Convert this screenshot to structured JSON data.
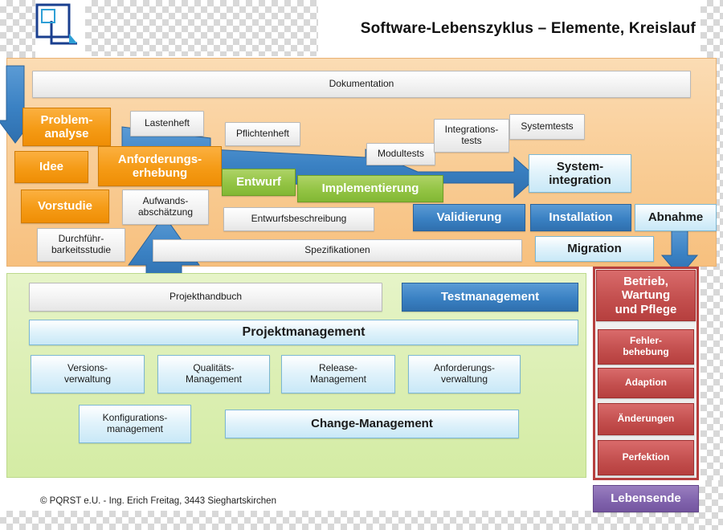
{
  "header": {
    "title": "Software-Lebenszyklus – Elemente, Kreislauf",
    "logo_name": "pqrst-logo"
  },
  "footer": {
    "copyright": "© PQRST e.U. - Ing. Erich Freitag, 3443 Sieghartskirchen"
  },
  "colors": {
    "orange": "#f59b16",
    "green": "#93c444",
    "blue": "#3a81c3",
    "cyan": "#c8e8f7",
    "red": "#c4504f",
    "purple": "#8265ae",
    "panel_orange": "#f9cd96",
    "panel_green": "#dcefb4"
  },
  "phase_panel": {
    "documentation": "Dokumentation",
    "boxes": [
      {
        "id": "problemanalyse",
        "label": "Problem-\nanalyse"
      },
      {
        "id": "idee",
        "label": "Idee"
      },
      {
        "id": "vorstudie",
        "label": "Vorstudie"
      },
      {
        "id": "durchfuehrbarkeitsstudie",
        "label": "Durchführ-\nbarkeitsstudie"
      },
      {
        "id": "lastenheft",
        "label": "Lastenheft"
      },
      {
        "id": "anforderungserhebung",
        "label": "Anforderungs-\nerhebung"
      },
      {
        "id": "aufwandsabschaetzung",
        "label": "Aufwands-\nabschätzung"
      },
      {
        "id": "pflichtenheft",
        "label": "Pflichtenheft"
      },
      {
        "id": "entwurf",
        "label": "Entwurf"
      },
      {
        "id": "entwurfsbeschreibung",
        "label": "Entwurfsbeschreibung"
      },
      {
        "id": "implementierung",
        "label": "Implementierung"
      },
      {
        "id": "modultests",
        "label": "Modultests"
      },
      {
        "id": "integrationstests",
        "label": "Integrations-\ntests"
      },
      {
        "id": "systemtests",
        "label": "Systemtests"
      },
      {
        "id": "systemintegration",
        "label": "System-\nintegration"
      },
      {
        "id": "validierung",
        "label": "Validierung"
      },
      {
        "id": "installation",
        "label": "Installation"
      },
      {
        "id": "abnahme",
        "label": "Abnahme"
      },
      {
        "id": "migration",
        "label": "Migration"
      },
      {
        "id": "spezifikationen",
        "label": "Spezifikationen"
      }
    ]
  },
  "management_panel": {
    "boxes": [
      {
        "id": "projekthandbuch",
        "label": "Projekthandbuch"
      },
      {
        "id": "testmanagement",
        "label": "Testmanagement"
      },
      {
        "id": "projektmanagement",
        "label": "Projektmanagement"
      },
      {
        "id": "versionsverwaltung",
        "label": "Versions-\nverwaltung"
      },
      {
        "id": "qualitaetsmanagement",
        "label": "Qualitäts-\nManagement"
      },
      {
        "id": "releasemanagement",
        "label": "Release-\nManagement"
      },
      {
        "id": "anforderungsverwaltung",
        "label": "Anforderungs-\nverwaltung"
      },
      {
        "id": "konfigurationsmanagement",
        "label": "Konfigurations-\nmanagement"
      },
      {
        "id": "changemanagement",
        "label": "Change-Management"
      }
    ]
  },
  "operation_panel": {
    "header": "Betrieb,\nWartung\nund Pflege",
    "items": [
      {
        "id": "fehlerbehebung",
        "label": "Fehler-\nbehebung"
      },
      {
        "id": "adaption",
        "label": "Adaption"
      },
      {
        "id": "aenderungen",
        "label": "Änderungen"
      },
      {
        "id": "perfektion",
        "label": "Perfektion"
      }
    ],
    "end": "Lebensende"
  }
}
